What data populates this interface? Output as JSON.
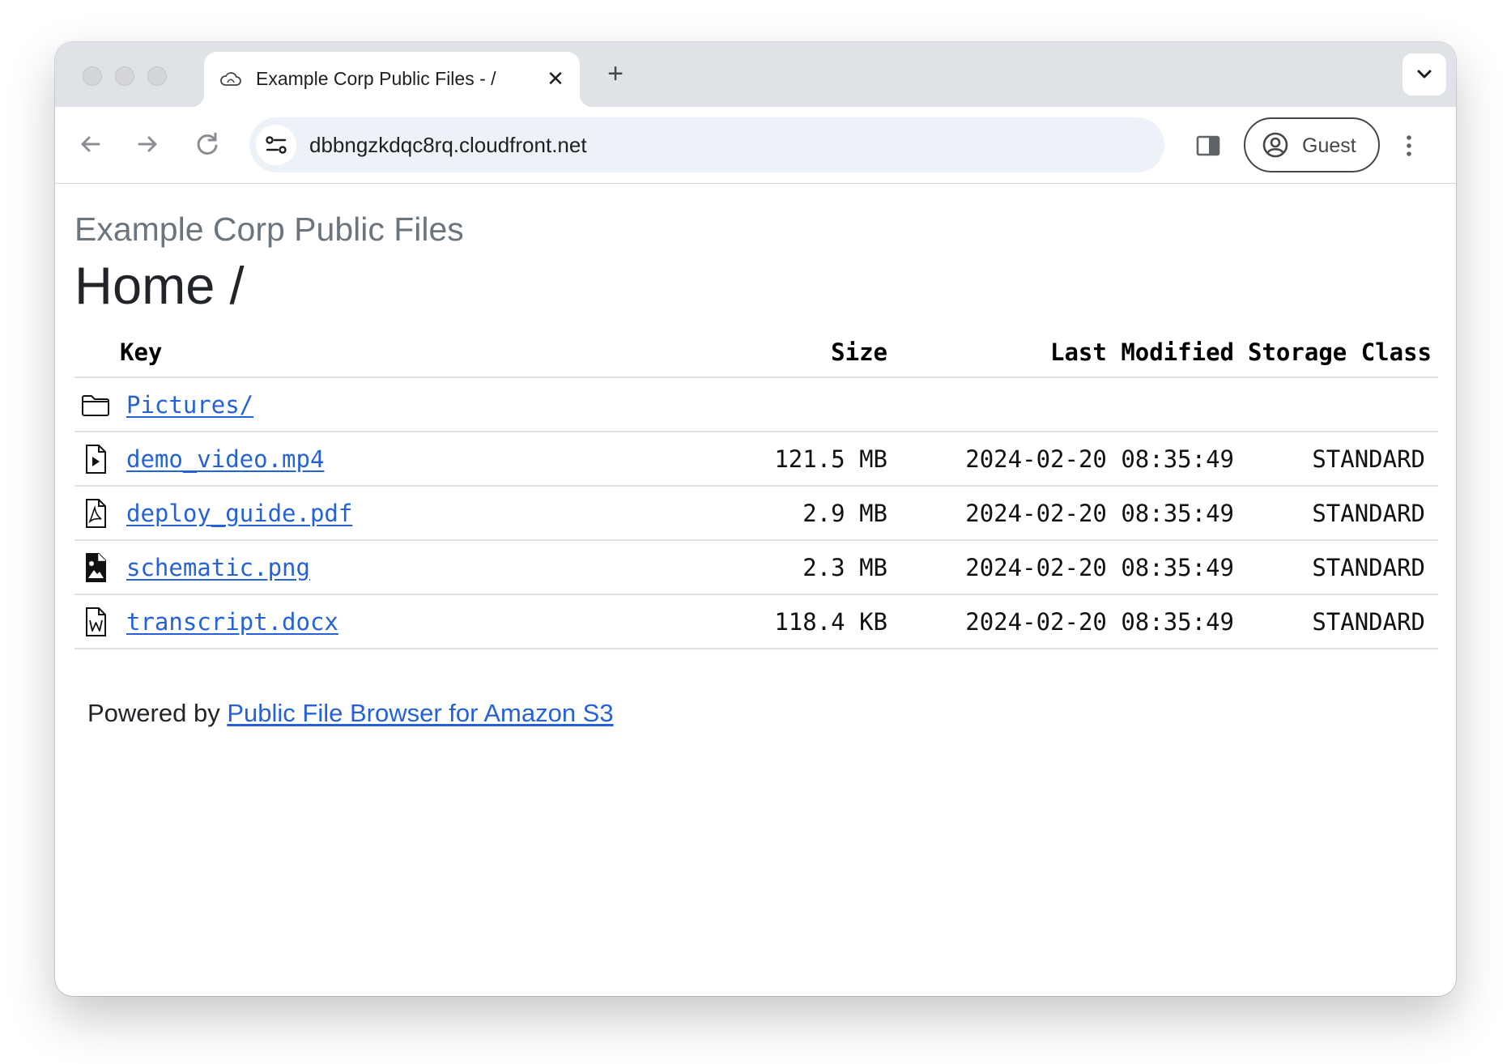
{
  "browser": {
    "tab_title": "Example Corp Public Files - /",
    "tab_close": "✕",
    "new_tab": "+",
    "url": "dbbngzkdqc8rq.cloudfront.net",
    "profile_label": "Guest"
  },
  "page": {
    "bucket_title": "Example Corp Public Files",
    "folder_title": "Home /",
    "columns": {
      "key": "Key",
      "size": "Size",
      "last_modified": "Last Modified",
      "storage_class": "Storage Class"
    },
    "rows": [
      {
        "icon": "folder-icon",
        "name": "Pictures/",
        "size": "",
        "modified": "",
        "storage_class": ""
      },
      {
        "icon": "video-file-icon",
        "name": "demo_video.mp4",
        "size": "121.5 MB",
        "modified": "2024-02-20 08:35:49",
        "storage_class": "STANDARD"
      },
      {
        "icon": "pdf-file-icon",
        "name": "deploy_guide.pdf",
        "size": "2.9 MB",
        "modified": "2024-02-20 08:35:49",
        "storage_class": "STANDARD"
      },
      {
        "icon": "image-file-icon",
        "name": "schematic.png",
        "size": "2.3 MB",
        "modified": "2024-02-20 08:35:49",
        "storage_class": "STANDARD"
      },
      {
        "icon": "word-file-icon",
        "name": "transcript.docx",
        "size": "118.4 KB",
        "modified": "2024-02-20 08:35:49",
        "storage_class": "STANDARD"
      }
    ],
    "footer": {
      "prefix": "Powered by",
      "link_text": "Public File Browser for Amazon S3"
    }
  },
  "colors": {
    "link": "#2562d8",
    "muted_title": "#6c757d",
    "tab_strip": "#dfe3e8",
    "omnibox": "#edf1f8"
  }
}
